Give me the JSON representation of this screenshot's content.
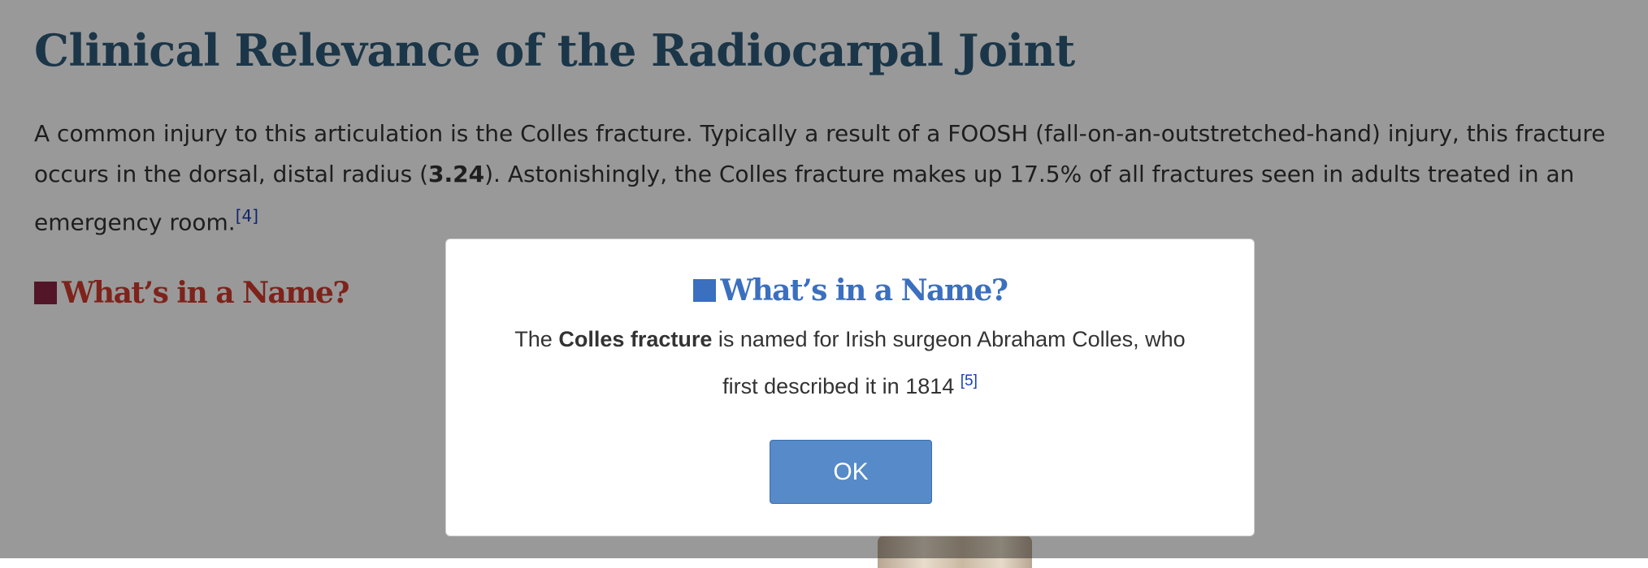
{
  "page": {
    "title": "Clinical Relevance of the Radiocarpal Joint",
    "paragraph": {
      "part1": "A common injury to this articulation is the Colles fracture. Typically a result of a FOOSH (fall-on-an-outstretched-hand) injury, this fracture occurs in the dorsal, distal radius (",
      "figure_ref": "3.24",
      "part2": "). Astonishingly, the Colles fracture makes up 17.5% of all fractures seen in adults treated in an emergency room.",
      "citation": "[4]"
    },
    "callout_heading": "What’s in a Name?"
  },
  "modal": {
    "heading": "What’s in a Name?",
    "text_prefix": "The ",
    "text_bold": "Colles fracture",
    "text_suffix": " is named for Irish surgeon Abraham Colles, who first described it in 1814 ",
    "citation": "[5]",
    "ok_label": "OK"
  },
  "colors": {
    "title": "#2e5a78",
    "callout_red": "#d13b2e",
    "callout_square": "#8b2545",
    "modal_heading": "#3b6fbf",
    "ok_button": "#568ac9",
    "citation_link": "#1a3fb8",
    "overlay": "rgba(0,0,0,0.40)"
  },
  "icons": {
    "callout_marker": "square-marker-icon",
    "modal_marker": "square-marker-icon"
  }
}
